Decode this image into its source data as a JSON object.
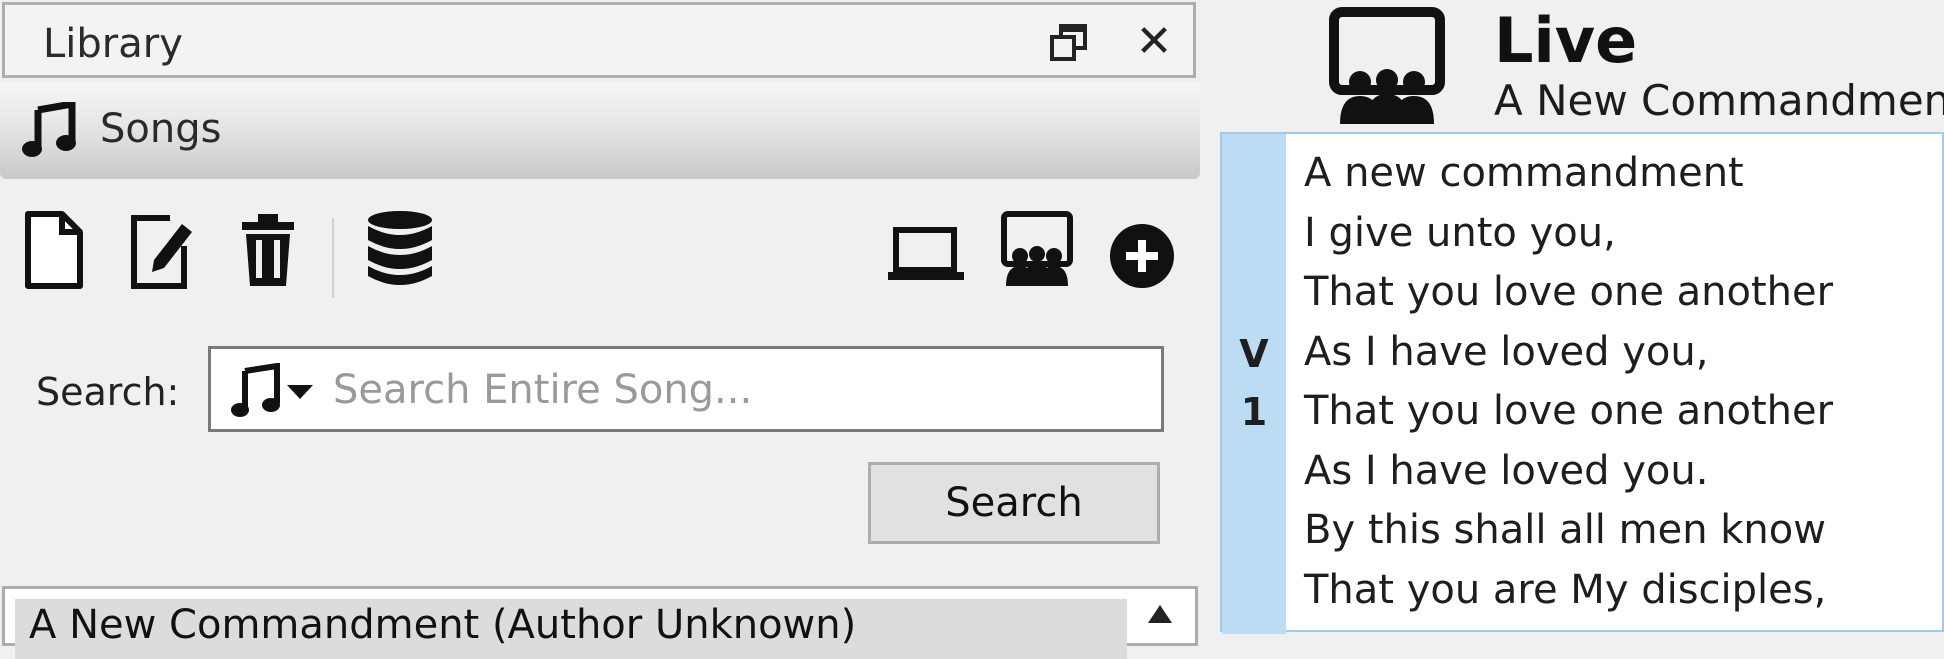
{
  "library": {
    "title": "Library",
    "section": "Songs",
    "toolbar": {
      "new": "new-song-icon",
      "edit": "edit-song-icon",
      "delete": "delete-song-icon",
      "import": "database-icon",
      "preview": "laptop-icon",
      "live": "presentation-icon",
      "add": "add-circle-icon"
    },
    "search": {
      "label": "Search:",
      "placeholder": "Search Entire Song...",
      "button": "Search"
    },
    "results": [
      "A New Commandment (Author Unknown)"
    ]
  },
  "live": {
    "title": "Live",
    "subtitle": "A New Commandment",
    "slide": {
      "tag_line1": "V",
      "tag_line2": "1",
      "lines": [
        "A new commandment",
        "I give unto you,",
        "That you love one another",
        "As I have loved you,",
        "That you love one another",
        "As I have loved you.",
        "By this shall all men know",
        "That you are My disciples,"
      ]
    }
  }
}
